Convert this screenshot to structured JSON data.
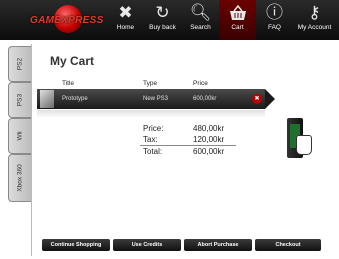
{
  "app": {
    "logo_text": "GAMEXPRESS"
  },
  "nav": [
    {
      "label": "Home",
      "icon": "x-icon"
    },
    {
      "label": "Buy back",
      "icon": "refresh-icon"
    },
    {
      "label": "Search",
      "icon": "magnifier-icon"
    },
    {
      "label": "Cart",
      "icon": "basket-icon"
    },
    {
      "label": "FAQ",
      "icon": "info-icon"
    },
    {
      "label": "My Account",
      "icon": "key-icon"
    }
  ],
  "side_tabs": [
    "PS2",
    "PS3",
    "Wii",
    "Xbox 360"
  ],
  "page": {
    "title": "My Cart"
  },
  "table": {
    "headers": [
      "Title",
      "Type",
      "Price"
    ],
    "rows": [
      {
        "title": "Prototype",
        "type": "New  PS3",
        "price": "600,00kr"
      }
    ]
  },
  "summary": {
    "price_label": "Price:",
    "price_value": "480,00kr",
    "tax_label": "Tax:",
    "tax_value": "120,00kr",
    "total_label": "Total:",
    "total_value": "600,00kr"
  },
  "buttons": {
    "continue": "Continue Shopping",
    "credits": "Use Credits",
    "abort": "Abort Purchase",
    "checkout": "Checkout"
  },
  "colors": {
    "accent": "#c40000",
    "bar": "#111111"
  }
}
